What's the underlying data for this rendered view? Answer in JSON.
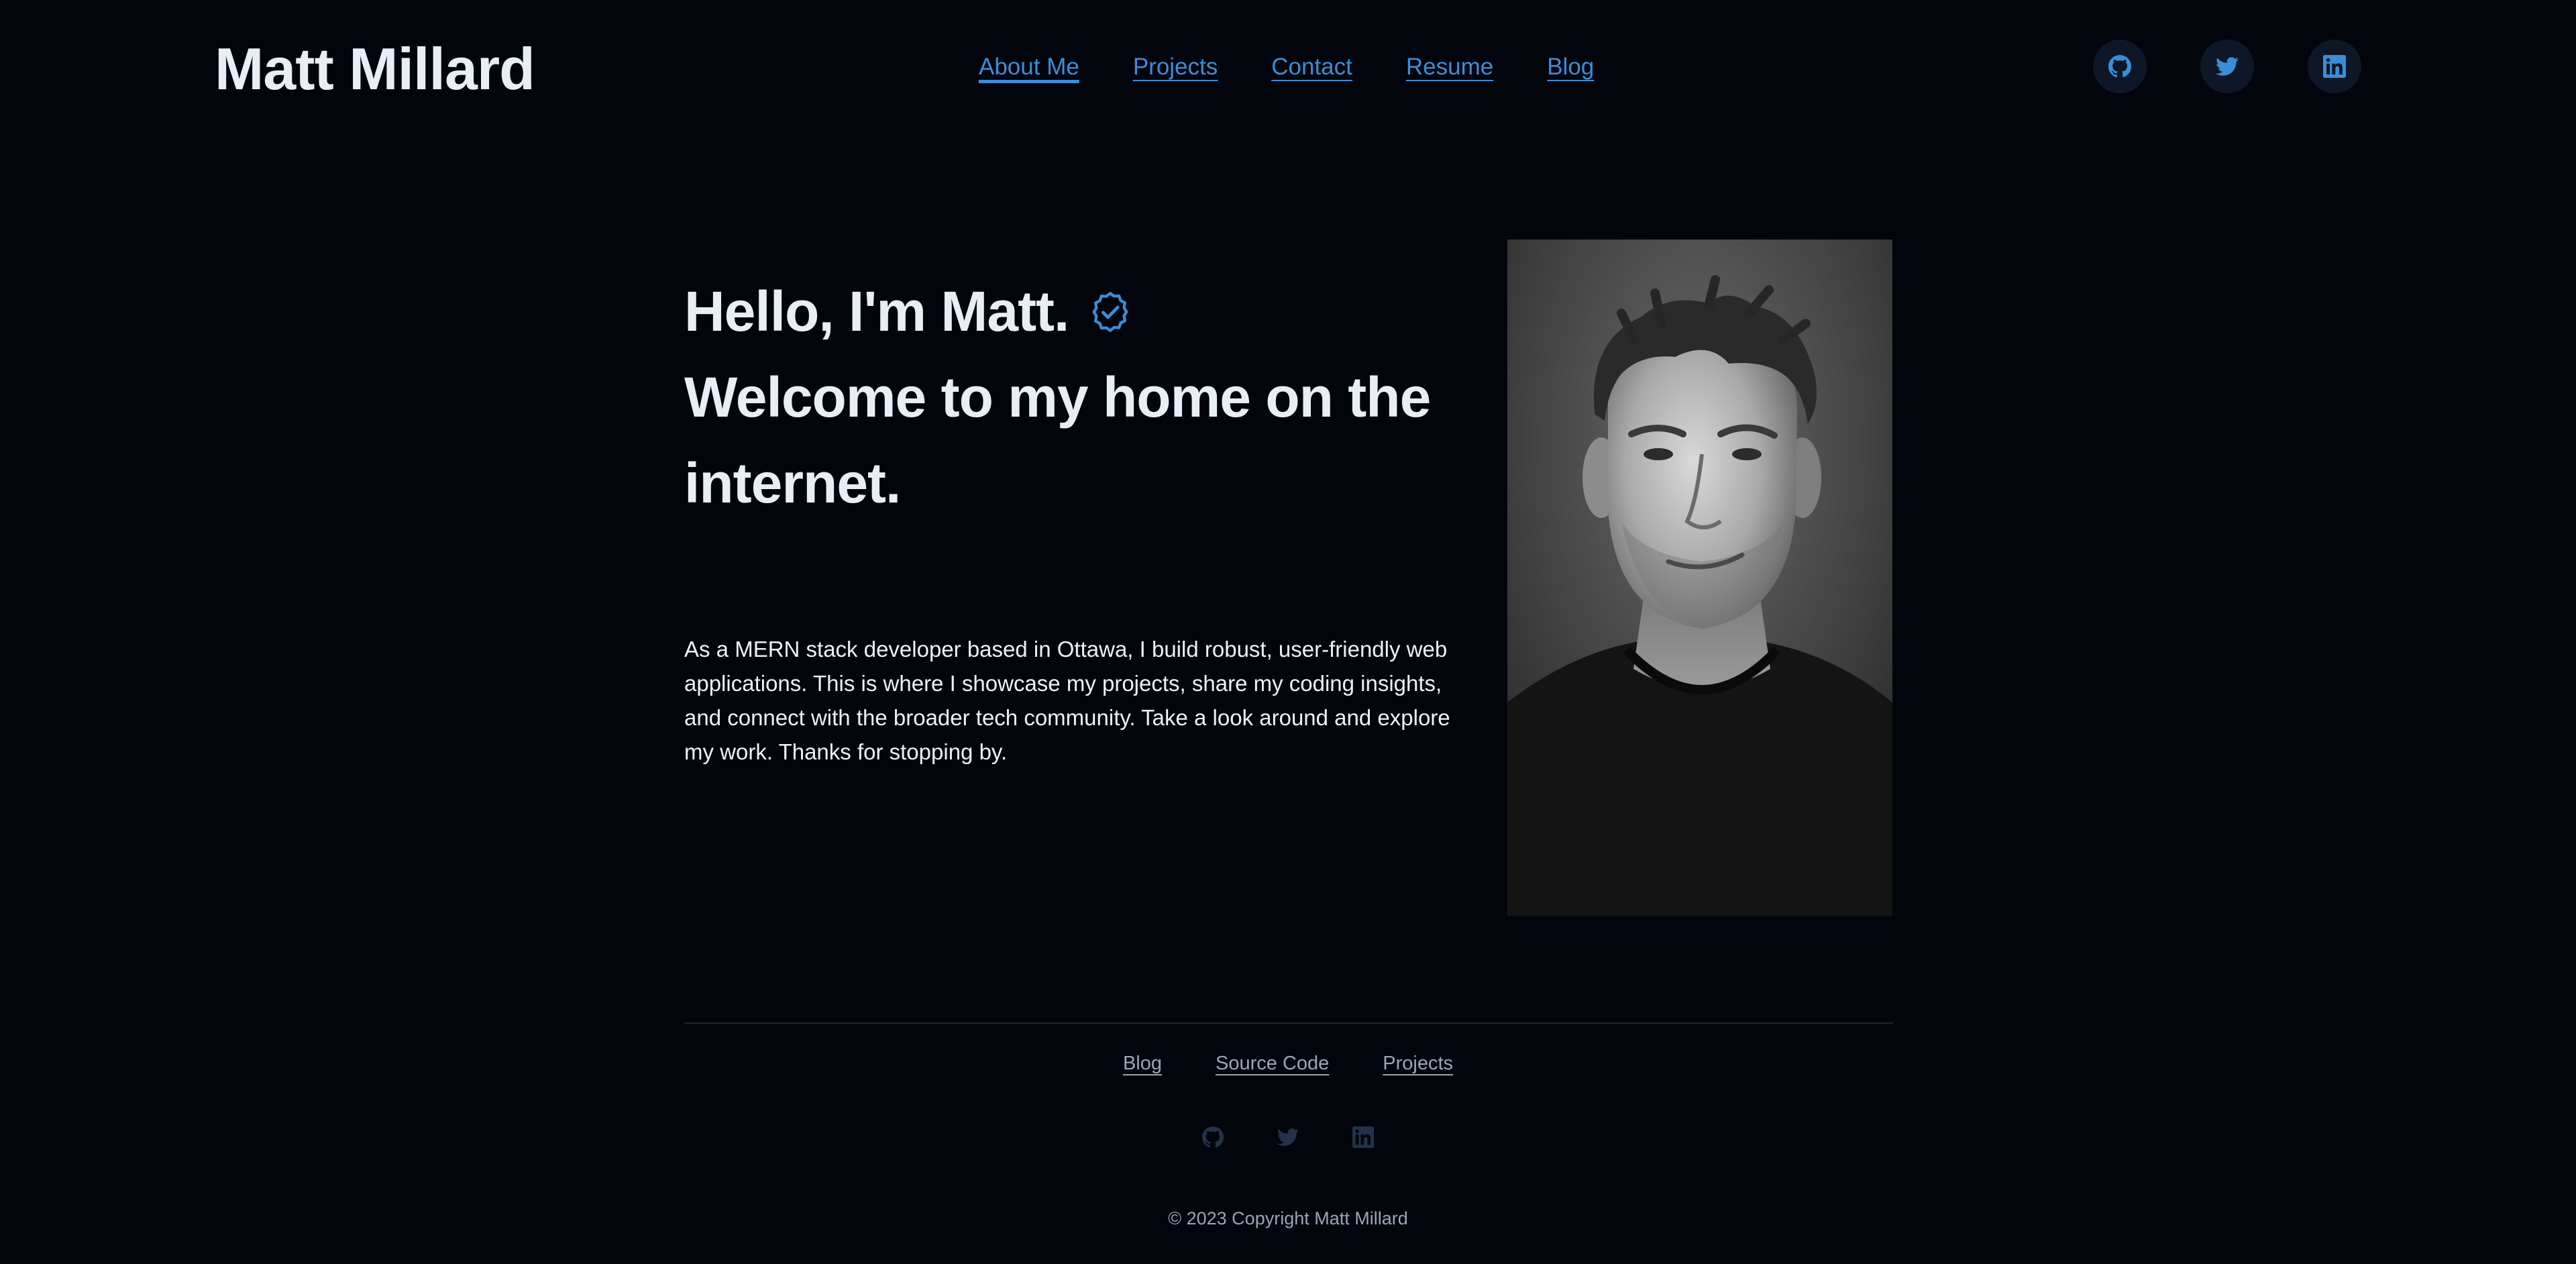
{
  "header": {
    "site_title": "Matt Millard",
    "nav": [
      {
        "label": "About Me",
        "active": true
      },
      {
        "label": "Projects"
      },
      {
        "label": "Contact"
      },
      {
        "label": "Resume"
      },
      {
        "label": "Blog"
      }
    ],
    "social_icons": [
      "github-icon",
      "twitter-icon",
      "linkedin-icon"
    ]
  },
  "hero": {
    "heading_line1": "Hello, I'm Matt.",
    "heading_line2": "Welcome to my home on the internet.",
    "badge_icon": "verified-badge-icon",
    "body": "As a MERN stack developer based in Ottawa, I build robust, user-friendly web applications. This is where I showcase my projects, share my coding insights, and connect with the broader tech community. Take a look around and explore my work. Thanks for stopping by.",
    "portrait_style": "black-and-white portrait photo"
  },
  "footer": {
    "links": [
      "Blog",
      "Source Code",
      "Projects"
    ],
    "social_icons": [
      "github-icon",
      "twitter-icon",
      "linkedin-icon"
    ],
    "copyright": "© 2023 Copyright Matt Millard"
  },
  "colors": {
    "background": "#03050d",
    "accent": "#3a8ed8",
    "text": "#e8eef6",
    "muted": "#9aa6b8",
    "icon_bg": "#0e1727"
  }
}
